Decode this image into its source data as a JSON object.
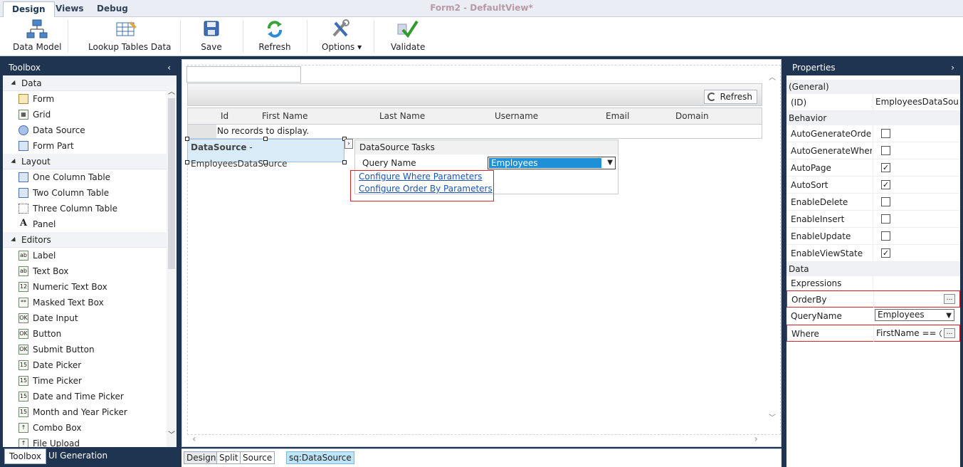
{
  "tabs": [
    {
      "label": "Design",
      "active": true
    },
    {
      "label": "Views",
      "active": false
    },
    {
      "label": "Debug",
      "active": false
    }
  ],
  "window_title": "Form2 - DefaultView*",
  "ribbon": {
    "data_model": "Data Model",
    "lookup_tables": "Lookup Tables Data",
    "save": "Save",
    "refresh": "Refresh",
    "options": "Options",
    "validate": "Validate"
  },
  "toolbox": {
    "title": "Toolbox",
    "collapse_glyph": "‹",
    "groups": [
      {
        "label": "Data",
        "items": [
          "Form",
          "Grid",
          "Data Source",
          "Form Part"
        ]
      },
      {
        "label": "Layout",
        "items": [
          "One Column Table",
          "Two Column Table",
          "Three Column Table",
          "Panel"
        ]
      },
      {
        "label": "Editors",
        "items": [
          "Label",
          "Text Box",
          "Numeric Text Box",
          "Masked Text Box",
          "Date Input",
          "Button",
          "Submit Button",
          "Date Picker",
          "Time Picker",
          "Date and Time Picker",
          "Month and Year Picker",
          "Combo Box",
          "File Upload"
        ]
      }
    ]
  },
  "bottom_tabs": {
    "toolbox": "Toolbox",
    "ui_generation": "UI Generation"
  },
  "designer": {
    "grid_refresh": "Refresh",
    "columns": [
      "Id",
      "First Name",
      "Last Name",
      "Username",
      "Email",
      "Domain"
    ],
    "no_records": "No records to display.",
    "datasource_label": "DataSource",
    "datasource_name": " - EmployeesDataSource",
    "tasks_title": "DataSource Tasks",
    "query_name_label": "Query Name",
    "query_name_value": "Employees",
    "link_where": "Configure Where Parameters",
    "link_orderby": "Configure Order By Parameters"
  },
  "view_tabs": {
    "design": "Design",
    "split": "Split",
    "source": "Source",
    "element": "sq:DataSource"
  },
  "properties": {
    "title": "Properties",
    "expand_glyph": "›",
    "general_label": "(General)",
    "id_label": "(ID)",
    "id_value": "EmployeesDataSource",
    "behavior_label": "Behavior",
    "behavior": [
      {
        "name": "AutoGenerateOrderByClause",
        "checked": false
      },
      {
        "name": "AutoGenerateWhereClause",
        "checked": false
      },
      {
        "name": "AutoPage",
        "checked": true
      },
      {
        "name": "AutoSort",
        "checked": true
      },
      {
        "name": "EnableDelete",
        "checked": false
      },
      {
        "name": "EnableInsert",
        "checked": false
      },
      {
        "name": "EnableUpdate",
        "checked": false
      },
      {
        "name": "EnableViewState",
        "checked": true
      }
    ],
    "data_label": "Data",
    "expressions_label": "Expressions",
    "orderby_label": "OrderBy",
    "queryname_label": "QueryName",
    "queryname_value": "Employees",
    "where_label": "Where",
    "where_value": "FirstName == @FirstName"
  },
  "colors": {
    "accent_red": "#d3262f",
    "panel_dark": "#1e3450",
    "link_blue": "#1a55b5"
  }
}
